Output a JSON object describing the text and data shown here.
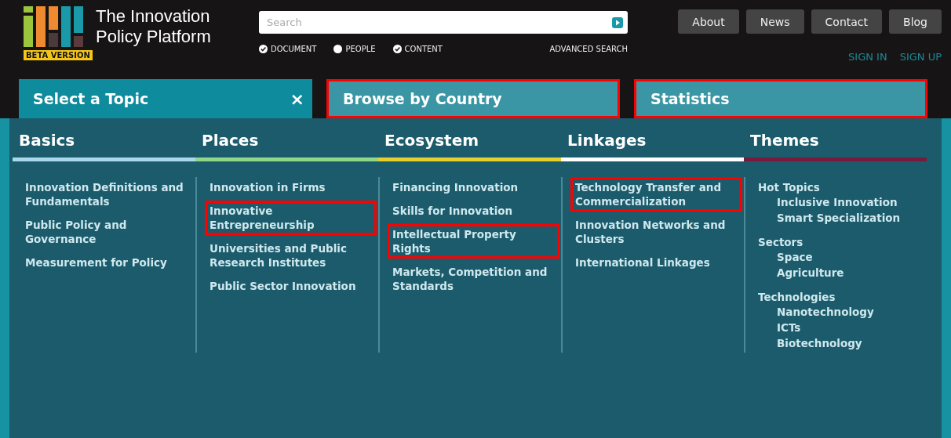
{
  "brand": {
    "title_line_1": "The Innovation",
    "title_line_2": "Policy Platform",
    "badge": "BETA VERSION"
  },
  "search": {
    "placeholder": "Search",
    "filters": [
      {
        "label": "DOCUMENT",
        "checked": true
      },
      {
        "label": "PEOPLE",
        "checked": false
      },
      {
        "label": "CONTENT",
        "checked": true
      }
    ],
    "advanced": "ADVANCED SEARCH"
  },
  "nav": [
    "About",
    "News",
    "Contact",
    "Blog"
  ],
  "account": [
    "SIGN IN",
    "SIGN UP"
  ],
  "tabs": [
    {
      "label": "Select a Topic",
      "selected": true,
      "highlighted": false,
      "close": "×"
    },
    {
      "label": "Browse by Country",
      "selected": false,
      "highlighted": true
    },
    {
      "label": "Statistics",
      "selected": false,
      "highlighted": true
    }
  ],
  "columns": [
    {
      "title": "Basics",
      "color": "#a8d8ea",
      "items": [
        {
          "label": "Innovation Definitions and Fundamentals",
          "highlighted": false
        },
        {
          "label": "Public Policy and Governance",
          "highlighted": false
        },
        {
          "label": "Measurement for Policy",
          "highlighted": false
        }
      ]
    },
    {
      "title": "Places",
      "color": "#8fd88a",
      "items": [
        {
          "label": "Innovation in Firms",
          "highlighted": false
        },
        {
          "label": "Innovative Entrepreneurship",
          "highlighted": true
        },
        {
          "label": "Universities and Public Research Institutes",
          "highlighted": false
        },
        {
          "label": "Public Sector Innovation",
          "highlighted": false
        }
      ]
    },
    {
      "title": "Ecosystem",
      "color": "#e6cf2a",
      "items": [
        {
          "label": "Financing Innovation",
          "highlighted": false
        },
        {
          "label": "Skills for Innovation",
          "highlighted": false
        },
        {
          "label": "Intellectual Property Rights",
          "highlighted": true
        },
        {
          "label": "Markets, Competition and Standards",
          "highlighted": false
        }
      ]
    },
    {
      "title": "Linkages",
      "color": "#ffffff",
      "items": [
        {
          "label": "Technology Transfer and Commercialization",
          "highlighted": true
        },
        {
          "label": "Innovation Networks and Clusters",
          "highlighted": false
        },
        {
          "label": "International Linkages",
          "highlighted": false
        }
      ]
    },
    {
      "title": "Themes",
      "color": "#7a1a3a",
      "items": [
        {
          "label": "Hot Topics",
          "highlighted": false,
          "children": [
            {
              "label": "Inclusive Innovation",
              "highlighted": false
            },
            {
              "label": "Smart Specialization",
              "highlighted": false
            }
          ]
        },
        {
          "label": "Sectors",
          "highlighted": false,
          "children": [
            {
              "label": "Space",
              "highlighted": false
            },
            {
              "label": "Agriculture",
              "highlighted": false
            }
          ]
        },
        {
          "label": "Technologies",
          "highlighted": false,
          "children": [
            {
              "label": "Nanotechnology",
              "highlighted": false
            },
            {
              "label": "ICTs",
              "highlighted": false
            },
            {
              "label": "Biotechnology",
              "highlighted": false
            }
          ]
        }
      ]
    }
  ]
}
